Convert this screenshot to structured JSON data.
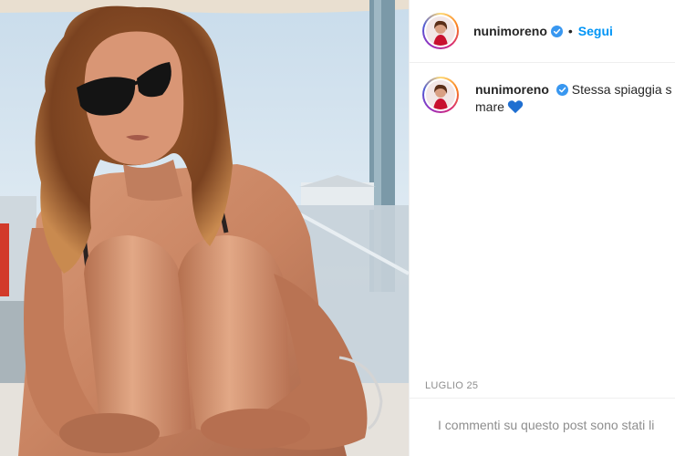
{
  "header": {
    "username": "nunimoreno",
    "separator": "•",
    "follow_label": "Segui"
  },
  "caption": {
    "username": "nunimoreno",
    "text_line1": "Stessa spiaggia s",
    "text_line2": "mare",
    "emoji": "blue-heart-icon"
  },
  "post": {
    "date": "LUGLIO 25",
    "comments_disabled": "I commenti su questo post sono stati li"
  },
  "colors": {
    "follow": "#0095f6",
    "verified": "#3897f0",
    "muted_text": "#8e8e8e",
    "heart": "#1f6fd1"
  }
}
